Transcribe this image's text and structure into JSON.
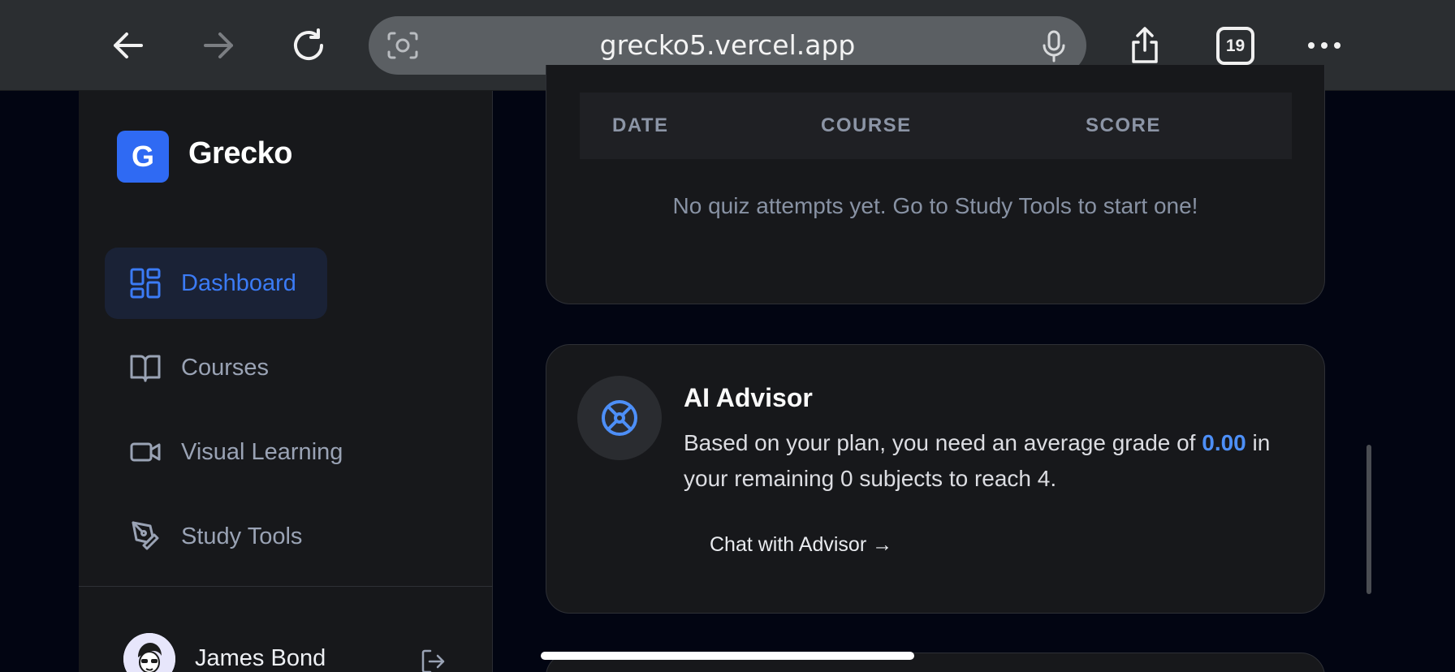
{
  "browser": {
    "url": "grecko5.vercel.app",
    "tab_count": "19"
  },
  "sidebar": {
    "logo_letter": "G",
    "app_name": "Grecko",
    "items": [
      {
        "label": "Dashboard",
        "icon": "dashboard-icon",
        "active": true
      },
      {
        "label": "Courses",
        "icon": "book-icon",
        "active": false
      },
      {
        "label": "Visual Learning",
        "icon": "video-icon",
        "active": false
      },
      {
        "label": "Study Tools",
        "icon": "pen-tool-icon",
        "active": false
      }
    ],
    "user": {
      "name": "James Bond"
    }
  },
  "quiz_table": {
    "columns": [
      "DATE",
      "COURSE",
      "SCORE"
    ],
    "empty_message": "No quiz attempts yet. Go to Study Tools to start one!"
  },
  "advisor": {
    "title": "AI Advisor",
    "text_before": "Based on your plan, you need an average grade of ",
    "highlight_value": "0.00",
    "text_after": " in your remaining 0 subjects to reach 4.",
    "link_label": "Chat with Advisor →"
  },
  "colors": {
    "accent": "#2f6af3",
    "highlight": "#4d8ff7",
    "background": "#020512",
    "card": "#17181b"
  }
}
